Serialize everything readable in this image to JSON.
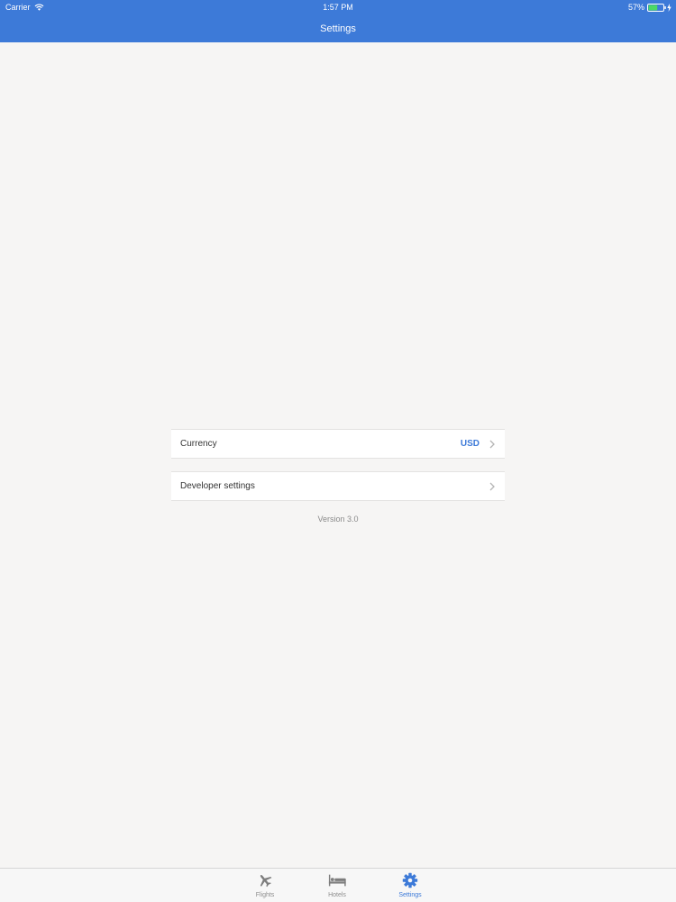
{
  "status_bar": {
    "carrier": "Carrier",
    "time": "1:57 PM",
    "battery": "57%"
  },
  "header": {
    "title": "Settings"
  },
  "settings": {
    "currency_label": "Currency",
    "currency_value": "USD",
    "developer_label": "Developer settings",
    "version": "Version 3.0"
  },
  "tabs": [
    {
      "label": "Flights",
      "icon": "airplane-icon",
      "active": false
    },
    {
      "label": "Hotels",
      "icon": "bed-icon",
      "active": false
    },
    {
      "label": "Settings",
      "icon": "gear-icon",
      "active": true
    }
  ],
  "colors": {
    "accent": "#3d7ad8",
    "background": "#f6f5f4",
    "battery": "#4cd964"
  }
}
